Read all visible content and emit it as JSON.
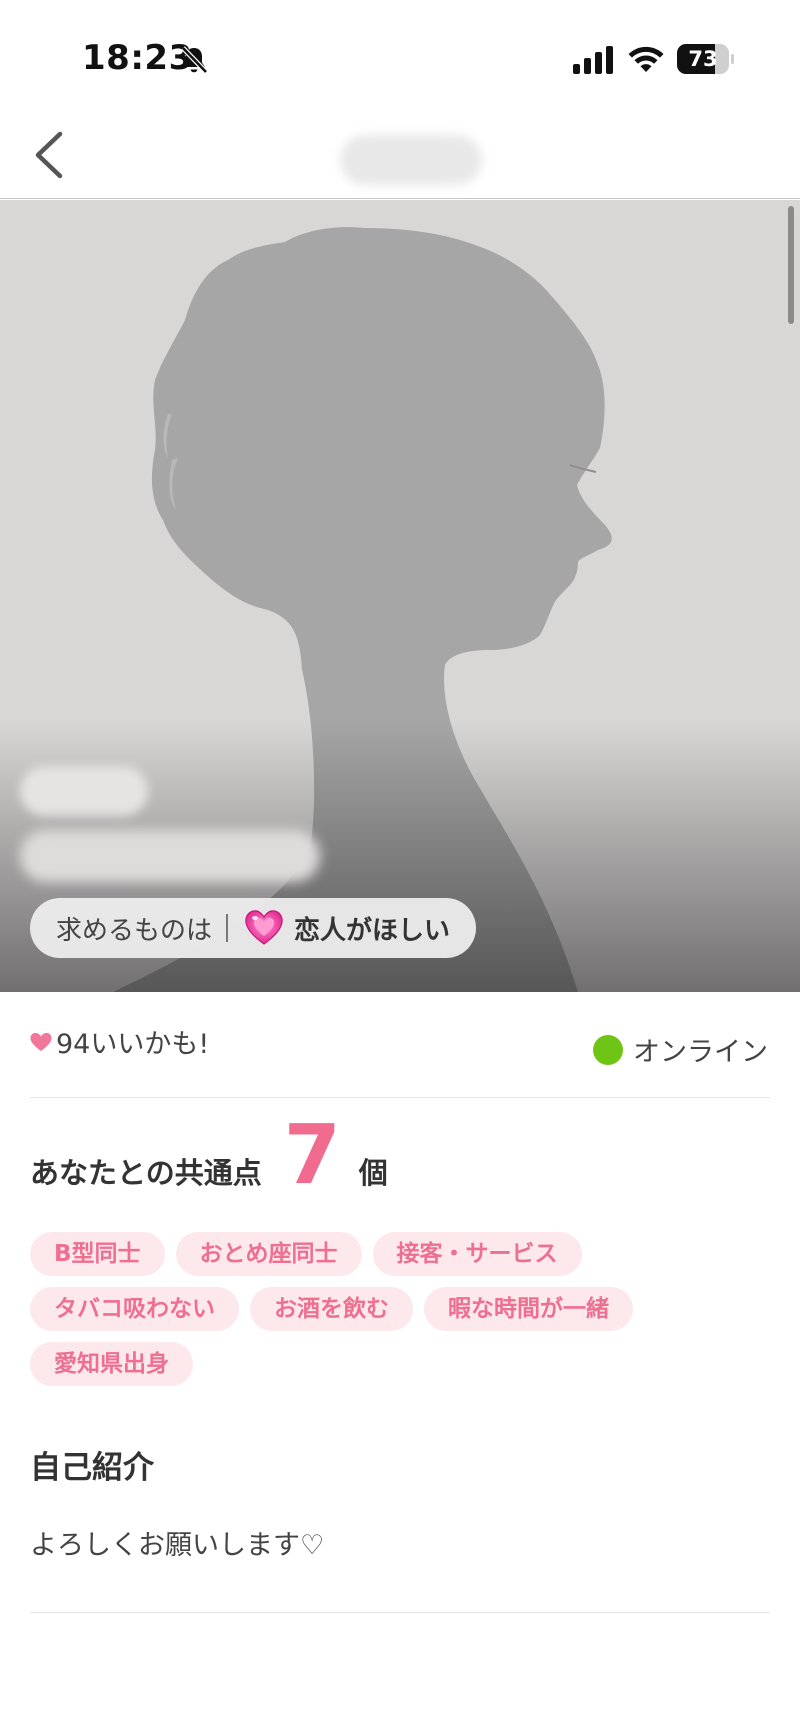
{
  "status_bar": {
    "time": "18:23",
    "battery_level": 73,
    "battery_text": "73",
    "icons": [
      "bell-slash-icon",
      "cellular-signal-icon",
      "wifi-icon",
      "battery-icon"
    ]
  },
  "nav": {
    "back_icon": "chevron-left-icon"
  },
  "photo": {
    "purpose_label": "求めるものは",
    "purpose_icon": "sparkling-heart-icon",
    "purpose_value": "恋人がほしい"
  },
  "stats": {
    "likes_icon": "heart-icon",
    "likes_text": "94いいかも!",
    "online_text": "オンライン",
    "online_color": "#6fc516"
  },
  "common_points": {
    "label": "あなたとの共通点",
    "count": "7",
    "unit": "個",
    "tag_rows": [
      [
        "B型同士",
        "おとめ座同士",
        "接客・サービス"
      ],
      [
        "タバコ吸わない",
        "お酒を飲む",
        "暇な時間が一緒"
      ],
      [
        "愛知県出身"
      ]
    ],
    "accent_color": "#f06b8e",
    "tag_bg_color": "#fde8ec"
  },
  "self_intro": {
    "title": "自己紹介",
    "text": "よろしくお願いします♡"
  }
}
